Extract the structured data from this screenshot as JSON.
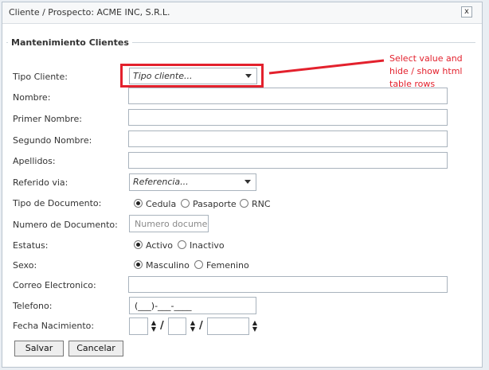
{
  "window": {
    "title": "Cliente / Prospecto: ACME INC, S.R.L.",
    "close_label": "x"
  },
  "section": {
    "legend": "Mantenimiento Clientes"
  },
  "fields": {
    "tipo_cliente": {
      "label": "Tipo Cliente:",
      "value": "Tipo cliente..."
    },
    "nombre": {
      "label": "Nombre:",
      "value": ""
    },
    "primer_nombre": {
      "label": "Primer Nombre:",
      "value": ""
    },
    "segundo_nombre": {
      "label": "Segundo Nombre:",
      "value": ""
    },
    "apellidos": {
      "label": "Apellidos:",
      "value": ""
    },
    "referido_via": {
      "label": "Referido via:",
      "value": "Referencia..."
    },
    "tipo_documento": {
      "label": "Tipo de Documento:",
      "options": [
        "Cedula",
        "Pasaporte",
        "RNC"
      ],
      "selected": "Cedula"
    },
    "numero_documento": {
      "label": "Numero de Documento:",
      "placeholder": "Numero documento"
    },
    "estatus": {
      "label": "Estatus:",
      "options": [
        "Activo",
        "Inactivo"
      ],
      "selected": "Activo"
    },
    "sexo": {
      "label": "Sexo:",
      "options": [
        "Masculino",
        "Femenino"
      ],
      "selected": "Masculino"
    },
    "correo": {
      "label": "Correo Electronico:",
      "value": ""
    },
    "telefono": {
      "label": "Telefono:",
      "value": "(___)-___-____"
    },
    "fecha_nacimiento": {
      "label": "Fecha Nacimiento:",
      "separator": "/"
    }
  },
  "buttons": {
    "save": "Salvar",
    "cancel": "Cancelar"
  },
  "annotation": {
    "text": "Select value and hide / show html table rows",
    "color": "#e3212d"
  }
}
